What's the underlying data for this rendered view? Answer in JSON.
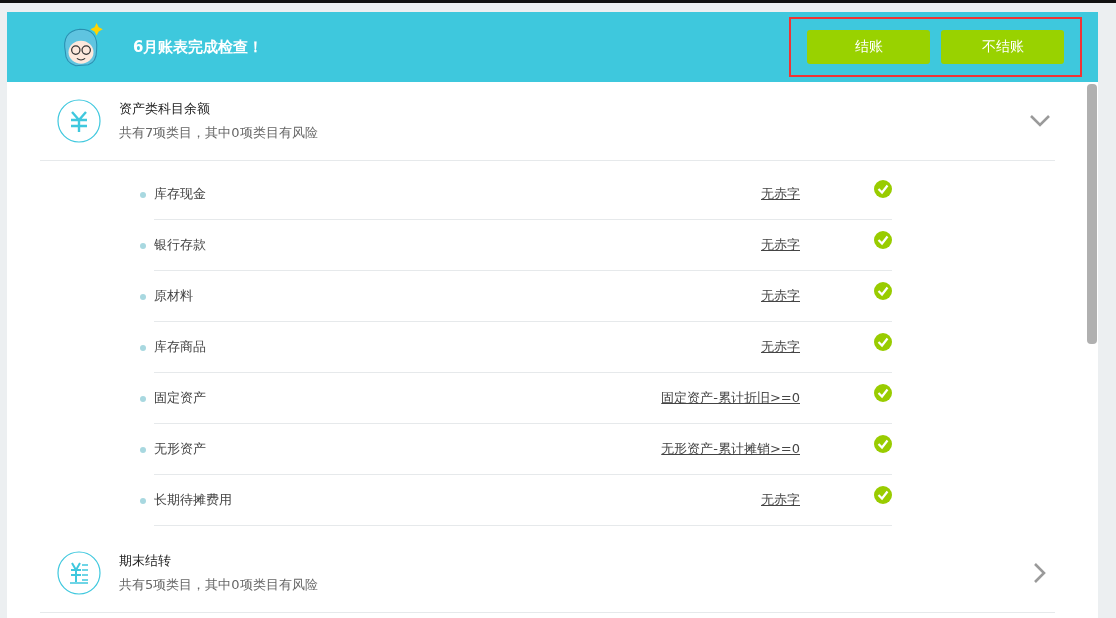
{
  "banner": {
    "message": "6月账表完成检查！",
    "buttons": [
      {
        "label": "结账"
      },
      {
        "label": "不结账"
      }
    ],
    "buttons_highlighted": true
  },
  "sections": [
    {
      "kind": "yuan",
      "title": "资产类科目余额",
      "summary": "共有7项类目，其中0项类目有风险",
      "expanded": true,
      "items": [
        {
          "name": "库存现金",
          "result": "无赤字",
          "passed": true
        },
        {
          "name": "银行存款",
          "result": "无赤字",
          "passed": true
        },
        {
          "name": "原材料",
          "result": "无赤字",
          "passed": true
        },
        {
          "name": "库存商品",
          "result": "无赤字",
          "passed": true
        },
        {
          "name": "固定资产",
          "result": "固定资产-累计折旧>=0",
          "passed": true
        },
        {
          "name": "无形资产",
          "result": "无形资产-累计摊销>=0",
          "passed": true
        },
        {
          "name": "长期待摊费用",
          "result": "无赤字",
          "passed": true
        }
      ]
    },
    {
      "kind": "ledger",
      "title": "期末结转",
      "summary": "共有5项类目，其中0项类目有风险",
      "expanded": false
    }
  ]
}
